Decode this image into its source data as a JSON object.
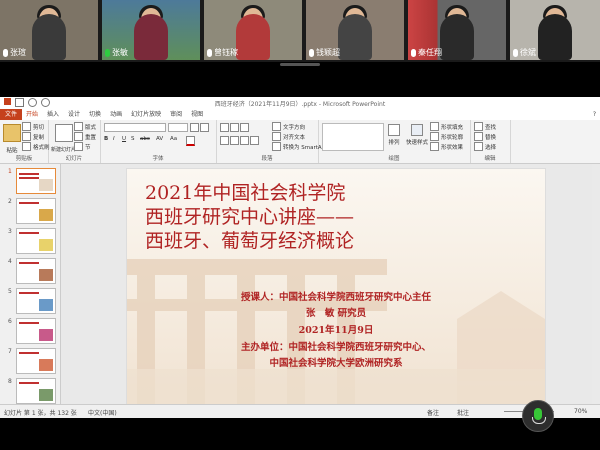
{
  "participants": [
    {
      "name": "张瑄",
      "mic": "muted"
    },
    {
      "name": "张敏",
      "mic": "speaking"
    },
    {
      "name": "曾钰稼",
      "mic": "muted"
    },
    {
      "name": "",
      "mic": "none"
    },
    {
      "name": "钱颖超",
      "mic": "muted"
    },
    {
      "name": "秦任翔",
      "mic": "muted"
    },
    {
      "name": "徐斌",
      "mic": "muted"
    }
  ],
  "ppt": {
    "window_title": "西班牙经济（2021年11月9日）.pptx - Microsoft PowerPoint",
    "file_tab": "文件",
    "tabs": [
      "开始",
      "插入",
      "设计",
      "切换",
      "动画",
      "幻灯片放映",
      "审阅",
      "视图"
    ],
    "active_tab": "开始",
    "ribbon": {
      "clipboard": {
        "paste": "粘贴",
        "cut": "剪切",
        "copy": "复制",
        "format_painter": "格式刷",
        "label": "剪贴板"
      },
      "slides": {
        "new_slide": "新建幻灯片",
        "layout": "版式",
        "reset": "重置",
        "section": "节",
        "label": "幻灯片"
      },
      "font": {
        "label": "字体",
        "bold": "B",
        "italic": "I",
        "underline": "U",
        "strike": "S",
        "shadow": "abc",
        "spacing": "AV",
        "case": "Aa"
      },
      "paragraph": {
        "text_direction": "文字方向",
        "align_text": "对齐文本",
        "smartart": "转换为 SmartArt",
        "label": "段落"
      },
      "drawing": {
        "arrange": "排列",
        "quick_styles": "快速样式",
        "shape_fill": "形状填充",
        "shape_outline": "形状轮廓",
        "shape_effects": "形状效果",
        "label": "绘图"
      },
      "editing": {
        "find": "查找",
        "replace": "替换",
        "select": "选择",
        "label": "编辑"
      }
    },
    "slide_numbers": [
      "1",
      "2",
      "3",
      "4",
      "5",
      "6",
      "7",
      "8"
    ],
    "slide": {
      "title_lines": [
        "2021年中国社会科学院",
        "西班牙研究中心讲座——",
        "西班牙、葡萄牙经济概论"
      ],
      "body_lines": [
        "授课人：中国社会科学院西班牙研究中心主任",
        "张　敏 研究员",
        "2021年11月9日",
        "主办单位：中国社会科学院西班牙研究中心、",
        "中国社会科学院大学欧洲研究系"
      ]
    },
    "status": {
      "slide_info": "幻灯片 第 1 张，共 132 张",
      "language": "中文(中国)",
      "notes": "备注",
      "comments": "批注",
      "zoom": "70%"
    },
    "help": "?"
  },
  "colors": {
    "accent": "#c5401c",
    "title_red": "#b02323",
    "speaking_green": "#2ecc40"
  }
}
